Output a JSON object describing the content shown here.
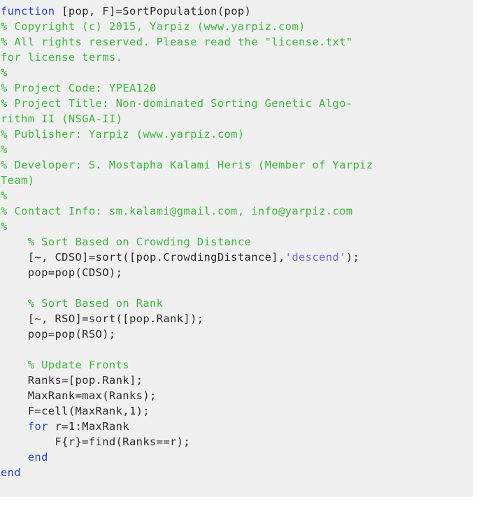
{
  "editor": {
    "language": "MATLAB",
    "background_color": "#f0f0f0",
    "colors": {
      "keyword": "#2b42cf",
      "comment": "#3cb83c",
      "string": "#7a6ae8",
      "code": "#2b2b2b"
    },
    "lines": [
      {
        "tokens": [
          {
            "t": "kw",
            "s": "function"
          },
          {
            "t": "code",
            "s": " [pop, F]=SortPopulation(pop)"
          }
        ]
      },
      {
        "tokens": [
          {
            "t": "comment",
            "s": "% Copyright (c) 2015, Yarpiz (www.yarpiz.com)"
          }
        ]
      },
      {
        "tokens": [
          {
            "t": "comment",
            "s": "% All rights reserved. Please read the \"license.txt\""
          }
        ]
      },
      {
        "tokens": [
          {
            "t": "comment",
            "s": "for license terms."
          }
        ]
      },
      {
        "tokens": [
          {
            "t": "comment",
            "s": "%"
          }
        ]
      },
      {
        "tokens": [
          {
            "t": "comment",
            "s": "% Project Code: YPEA120"
          }
        ]
      },
      {
        "tokens": [
          {
            "t": "comment",
            "s": "% Project Title: Non-dominated Sorting Genetic Algo-"
          }
        ]
      },
      {
        "tokens": [
          {
            "t": "comment",
            "s": "rithm II (NSGA-II)"
          }
        ]
      },
      {
        "tokens": [
          {
            "t": "comment",
            "s": "% Publisher: Yarpiz (www.yarpiz.com)"
          }
        ]
      },
      {
        "tokens": [
          {
            "t": "comment",
            "s": "%"
          }
        ]
      },
      {
        "tokens": [
          {
            "t": "comment",
            "s": "% Developer: S. Mostapha Kalami Heris (Member of Yarpiz"
          }
        ]
      },
      {
        "tokens": [
          {
            "t": "comment",
            "s": "Team)"
          }
        ]
      },
      {
        "tokens": [
          {
            "t": "comment",
            "s": "%"
          }
        ]
      },
      {
        "tokens": [
          {
            "t": "comment",
            "s": "% Contact Info: sm.kalami@gmail.com, info@yarpiz.com"
          }
        ]
      },
      {
        "tokens": [
          {
            "t": "comment",
            "s": "%"
          }
        ]
      },
      {
        "tokens": [
          {
            "t": "comment",
            "s": "    % Sort Based on Crowding Distance"
          }
        ]
      },
      {
        "tokens": [
          {
            "t": "code",
            "s": "    [~, CDSO]=sort([pop.CrowdingDistance],"
          },
          {
            "t": "string",
            "s": "'descend'"
          },
          {
            "t": "code",
            "s": ");"
          }
        ]
      },
      {
        "tokens": [
          {
            "t": "code",
            "s": "    pop=pop(CDSO);"
          }
        ]
      },
      {
        "tokens": [
          {
            "t": "code",
            "s": ""
          }
        ]
      },
      {
        "tokens": [
          {
            "t": "comment",
            "s": "    % Sort Based on Rank"
          }
        ]
      },
      {
        "tokens": [
          {
            "t": "code",
            "s": "    [~, RSO]=sort([pop.Rank]);"
          }
        ]
      },
      {
        "tokens": [
          {
            "t": "code",
            "s": "    pop=pop(RSO);"
          }
        ]
      },
      {
        "tokens": [
          {
            "t": "code",
            "s": ""
          }
        ]
      },
      {
        "tokens": [
          {
            "t": "comment",
            "s": "    % Update Fronts"
          }
        ]
      },
      {
        "tokens": [
          {
            "t": "code",
            "s": "    Ranks=[pop.Rank];"
          }
        ]
      },
      {
        "tokens": [
          {
            "t": "code",
            "s": "    MaxRank=max(Ranks);"
          }
        ]
      },
      {
        "tokens": [
          {
            "t": "code",
            "s": "    F=cell(MaxRank,1);"
          }
        ]
      },
      {
        "tokens": [
          {
            "t": "code",
            "s": "    "
          },
          {
            "t": "kw",
            "s": "for"
          },
          {
            "t": "code",
            "s": " r=1:MaxRank"
          }
        ]
      },
      {
        "tokens": [
          {
            "t": "code",
            "s": "        F{r}=find(Ranks==r);"
          }
        ]
      },
      {
        "tokens": [
          {
            "t": "code",
            "s": "    "
          },
          {
            "t": "kw",
            "s": "end"
          }
        ]
      },
      {
        "tokens": [
          {
            "t": "kw",
            "s": "end"
          }
        ]
      }
    ]
  }
}
